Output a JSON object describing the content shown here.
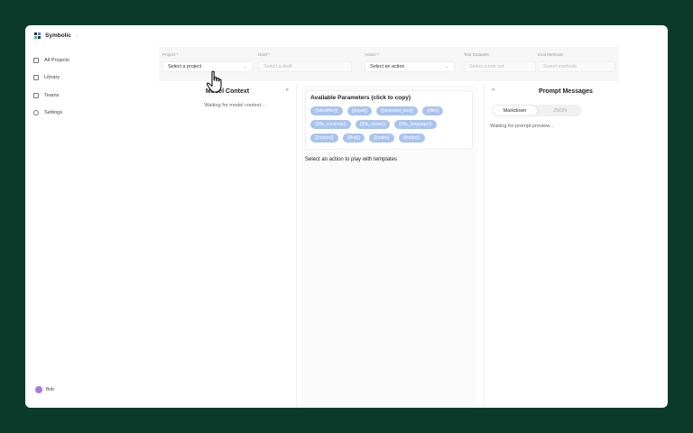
{
  "app": {
    "title": "Symbolic",
    "title_badge": "↕"
  },
  "sidebar": {
    "items": [
      {
        "label": "All Projects",
        "icon": "grid-icon"
      },
      {
        "label": "Library",
        "icon": "book-icon"
      },
      {
        "label": "Teams",
        "icon": "users-icon"
      },
      {
        "label": "Settings",
        "icon": "gear-icon"
      }
    ],
    "user": {
      "name": "Bob"
    }
  },
  "topbar": {
    "project": {
      "label": "Project *",
      "value": "Select a project"
    },
    "draft": {
      "label": "Draft *",
      "value": "Select a draft"
    },
    "action": {
      "label": "Action *",
      "value": "Select an action"
    },
    "test_datasets": {
      "label": "Test Datasets",
      "value": "Select a test set"
    },
    "eval_methods": {
      "label": "Eval Methods",
      "value": "Select methods"
    }
  },
  "model_context": {
    "title": "Model Context",
    "status": "Waiting for model context...",
    "collapse_glyph": "«"
  },
  "params": {
    "title": "Available Parameters (click to copy)",
    "chips": [
      "{{identifier}}",
      "{{input}}",
      "{{selected_text}}",
      "{{file}}",
      "{{file_contents}}",
      "{{file_name}}",
      "{{file_language}}",
      "{{cursor}}",
      "{{line}}",
      "{{code}}",
      "{{todos}}"
    ],
    "note": "Select an action to play with templates"
  },
  "prompt": {
    "title": "Prompt Messages",
    "collapse_glyph": "»",
    "tabs": [
      "Markdown",
      "JSON"
    ],
    "status": "Waiting for prompt preview..."
  }
}
